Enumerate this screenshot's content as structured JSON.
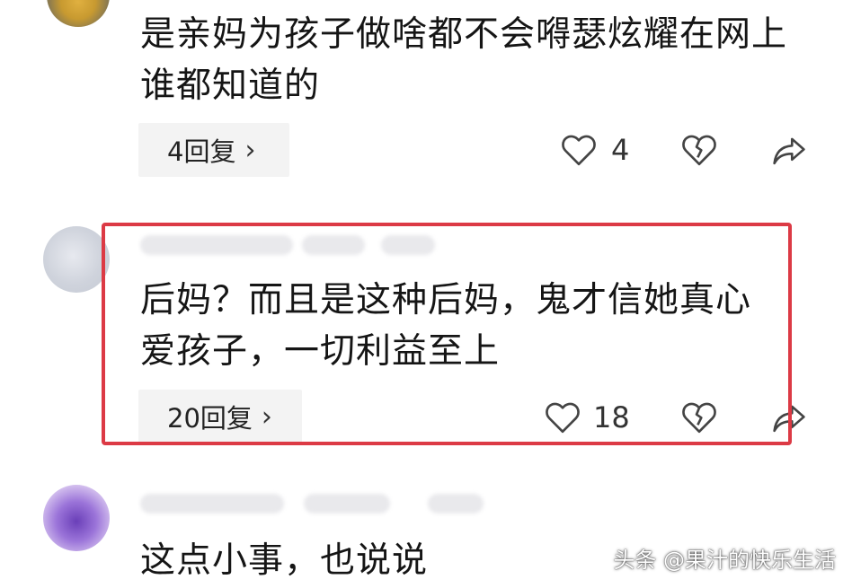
{
  "comments": [
    {
      "text": "是亲妈为孩子做啥都不会嘚瑟炫耀在网上谁都知道的",
      "replies_label": "4回复",
      "like_count": "4"
    },
    {
      "text": "后妈？而且是这种后妈，鬼才信她真心爱孩子，一切利益至上",
      "replies_label": "20回复",
      "like_count": "18"
    },
    {
      "text": "这点小事，也说说"
    }
  ],
  "watermark": "头条 @果汁的快乐生活",
  "colors": {
    "highlight_border": "#dc3a45",
    "reply_pill_bg": "#f3f3f3",
    "icon_gray": "#444444"
  },
  "icons": [
    "heart-outline-icon",
    "broken-heart-icon",
    "share-arrow-icon",
    "chevron-right-icon"
  ]
}
